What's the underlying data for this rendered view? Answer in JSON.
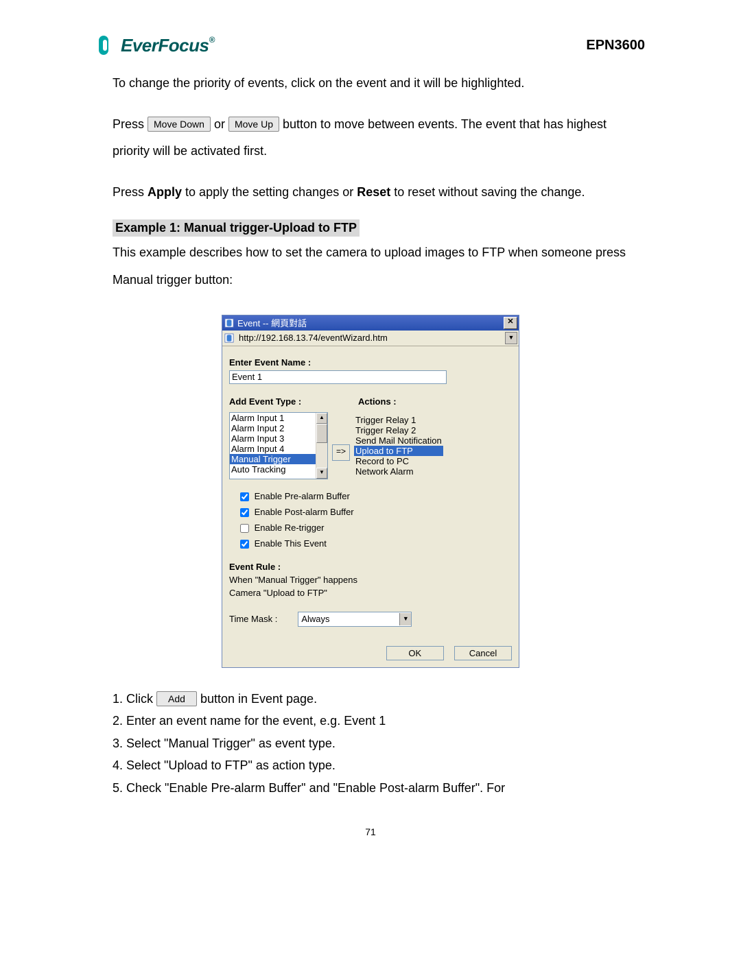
{
  "header": {
    "brand": "EverFocus",
    "product": "EPN3600"
  },
  "para1": "To change the priority of events, click on the event and it will be highlighted.",
  "para2_a": "Press ",
  "btn_move_down": "Move Down",
  "para2_b": " or ",
  "btn_move_up": "Move Up",
  "para2_c": " button to move between events. The event that has highest priority will be activated first.",
  "para3_a": "Press ",
  "para3_apply": "Apply",
  "para3_b": " to apply the setting changes or ",
  "para3_reset": "Reset",
  "para3_c": " to reset without saving the change.",
  "example_title": "Example 1: Manual trigger-Upload to FTP",
  "example_desc": "This example describes how to set the camera to upload images to FTP when someone press Manual trigger button:",
  "dialog": {
    "title": "Event -- 網頁對話",
    "url": "http://192.168.13.74/eventWizard.htm",
    "enter_name_label": "Enter Event Name :",
    "event_name_value": "Event 1",
    "add_type_label": "Add Event Type :",
    "actions_label": "Actions :",
    "event_types": [
      "Alarm Input 1",
      "Alarm Input 2",
      "Alarm Input 3",
      "Alarm Input 4",
      "Manual Trigger",
      "Auto Tracking"
    ],
    "event_types_selected_index": 4,
    "arrow_label": "=>",
    "actions": [
      "Trigger Relay 1",
      "Trigger Relay 2",
      "Send Mail Notification",
      "Upload to FTP",
      "Record to PC",
      "Network Alarm"
    ],
    "actions_selected_index": 3,
    "cb_prealarm": "Enable Pre-alarm Buffer",
    "cb_postalarm": "Enable Post-alarm Buffer",
    "cb_retrigger": "Enable Re-trigger",
    "cb_thisevent": "Enable This Event",
    "rule_label": "Event Rule :",
    "rule_line1": "When \"Manual Trigger\" happens",
    "rule_line2": "Camera \"Upload to FTP\"",
    "timemask_label": "Time Mask :",
    "timemask_value": "Always",
    "ok": "OK",
    "cancel": "Cancel"
  },
  "steps": {
    "s1a": "Click ",
    "s1_btn": "Add",
    "s1b": " button in Event page.",
    "s2": "Enter an event name for the event, e.g. Event 1",
    "s3": "Select \"Manual Trigger\" as event type.",
    "s4": "Select \"Upload to FTP\" as action type.",
    "s5": "Check \"Enable Pre-alarm Buffer\" and \"Enable Post-alarm Buffer\". For"
  },
  "page_number": "71"
}
